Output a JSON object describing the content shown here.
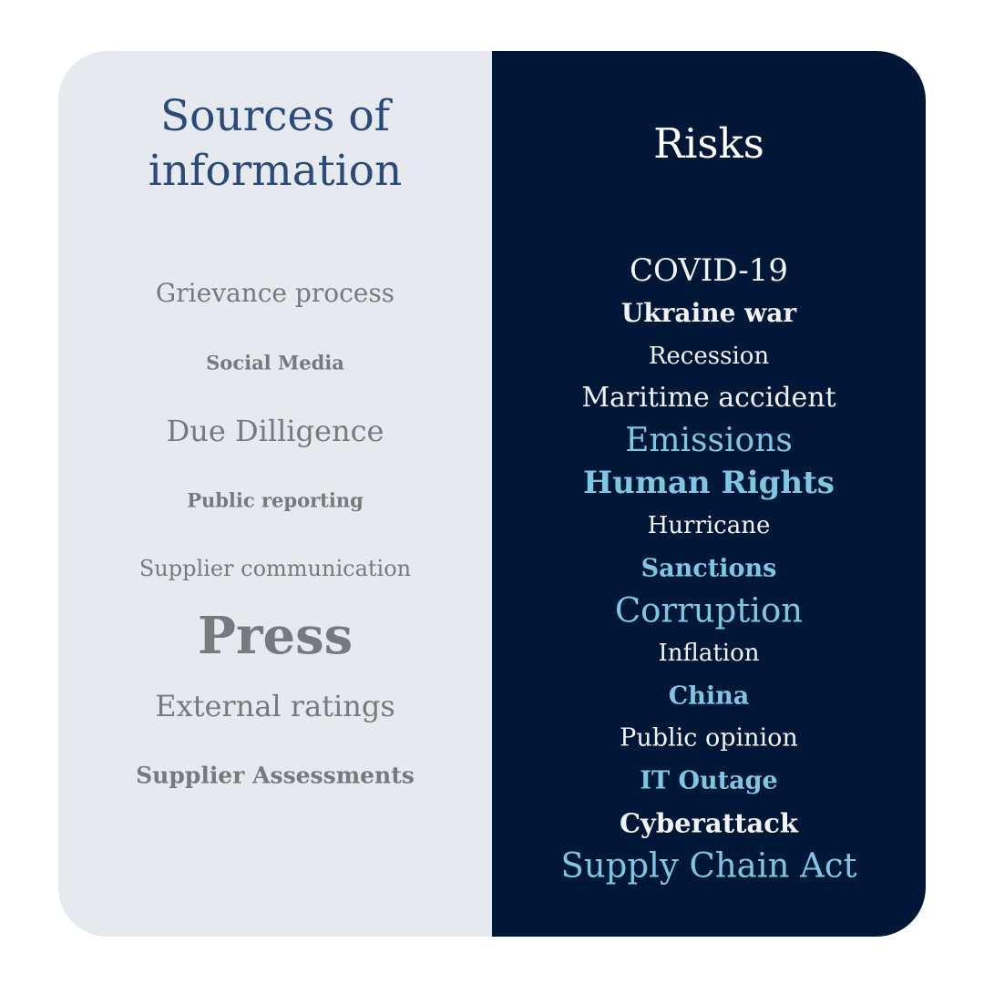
{
  "sources": {
    "title_line1": "Sources of",
    "title_line2": "information",
    "color": "#294a7a",
    "items": [
      {
        "label": "Grievance process",
        "weight": "light"
      },
      {
        "label": "Social Media",
        "weight": "bold"
      },
      {
        "label": "Due Dilligence",
        "weight": "light"
      },
      {
        "label": "Public reporting",
        "weight": "bold"
      },
      {
        "label": "Supplier communication",
        "weight": "light"
      },
      {
        "label": "Press",
        "weight": "bold"
      },
      {
        "label": "External ratings",
        "weight": "light"
      },
      {
        "label": "Supplier Assessments",
        "weight": "bold"
      }
    ]
  },
  "risks": {
    "title": "Risks",
    "colors": {
      "white": "#f2f3f5",
      "blue": "#7ec6e2",
      "background": "#011738"
    },
    "items": [
      {
        "label": "COVID-19",
        "weight": "light",
        "color": "white"
      },
      {
        "label": "Ukraine war",
        "weight": "bold",
        "color": "white"
      },
      {
        "label": "Recession",
        "weight": "light",
        "color": "white"
      },
      {
        "label": "Maritime accident",
        "weight": "light",
        "color": "white"
      },
      {
        "label": "Emissions",
        "weight": "light",
        "color": "blue"
      },
      {
        "label": "Human Rights",
        "weight": "bold",
        "color": "blue"
      },
      {
        "label": "Hurricane",
        "weight": "light",
        "color": "white"
      },
      {
        "label": "Sanctions",
        "weight": "bold",
        "color": "blue"
      },
      {
        "label": "Corruption",
        "weight": "light",
        "color": "blue"
      },
      {
        "label": "Inflation",
        "weight": "light",
        "color": "white"
      },
      {
        "label": "China",
        "weight": "bold",
        "color": "blue"
      },
      {
        "label": "Public opinion",
        "weight": "light",
        "color": "white"
      },
      {
        "label": "IT Outage",
        "weight": "bold",
        "color": "blue"
      },
      {
        "label": "Cyberattack",
        "weight": "bold",
        "color": "white"
      },
      {
        "label": "Supply Chain Act",
        "weight": "light",
        "color": "blue"
      }
    ]
  }
}
